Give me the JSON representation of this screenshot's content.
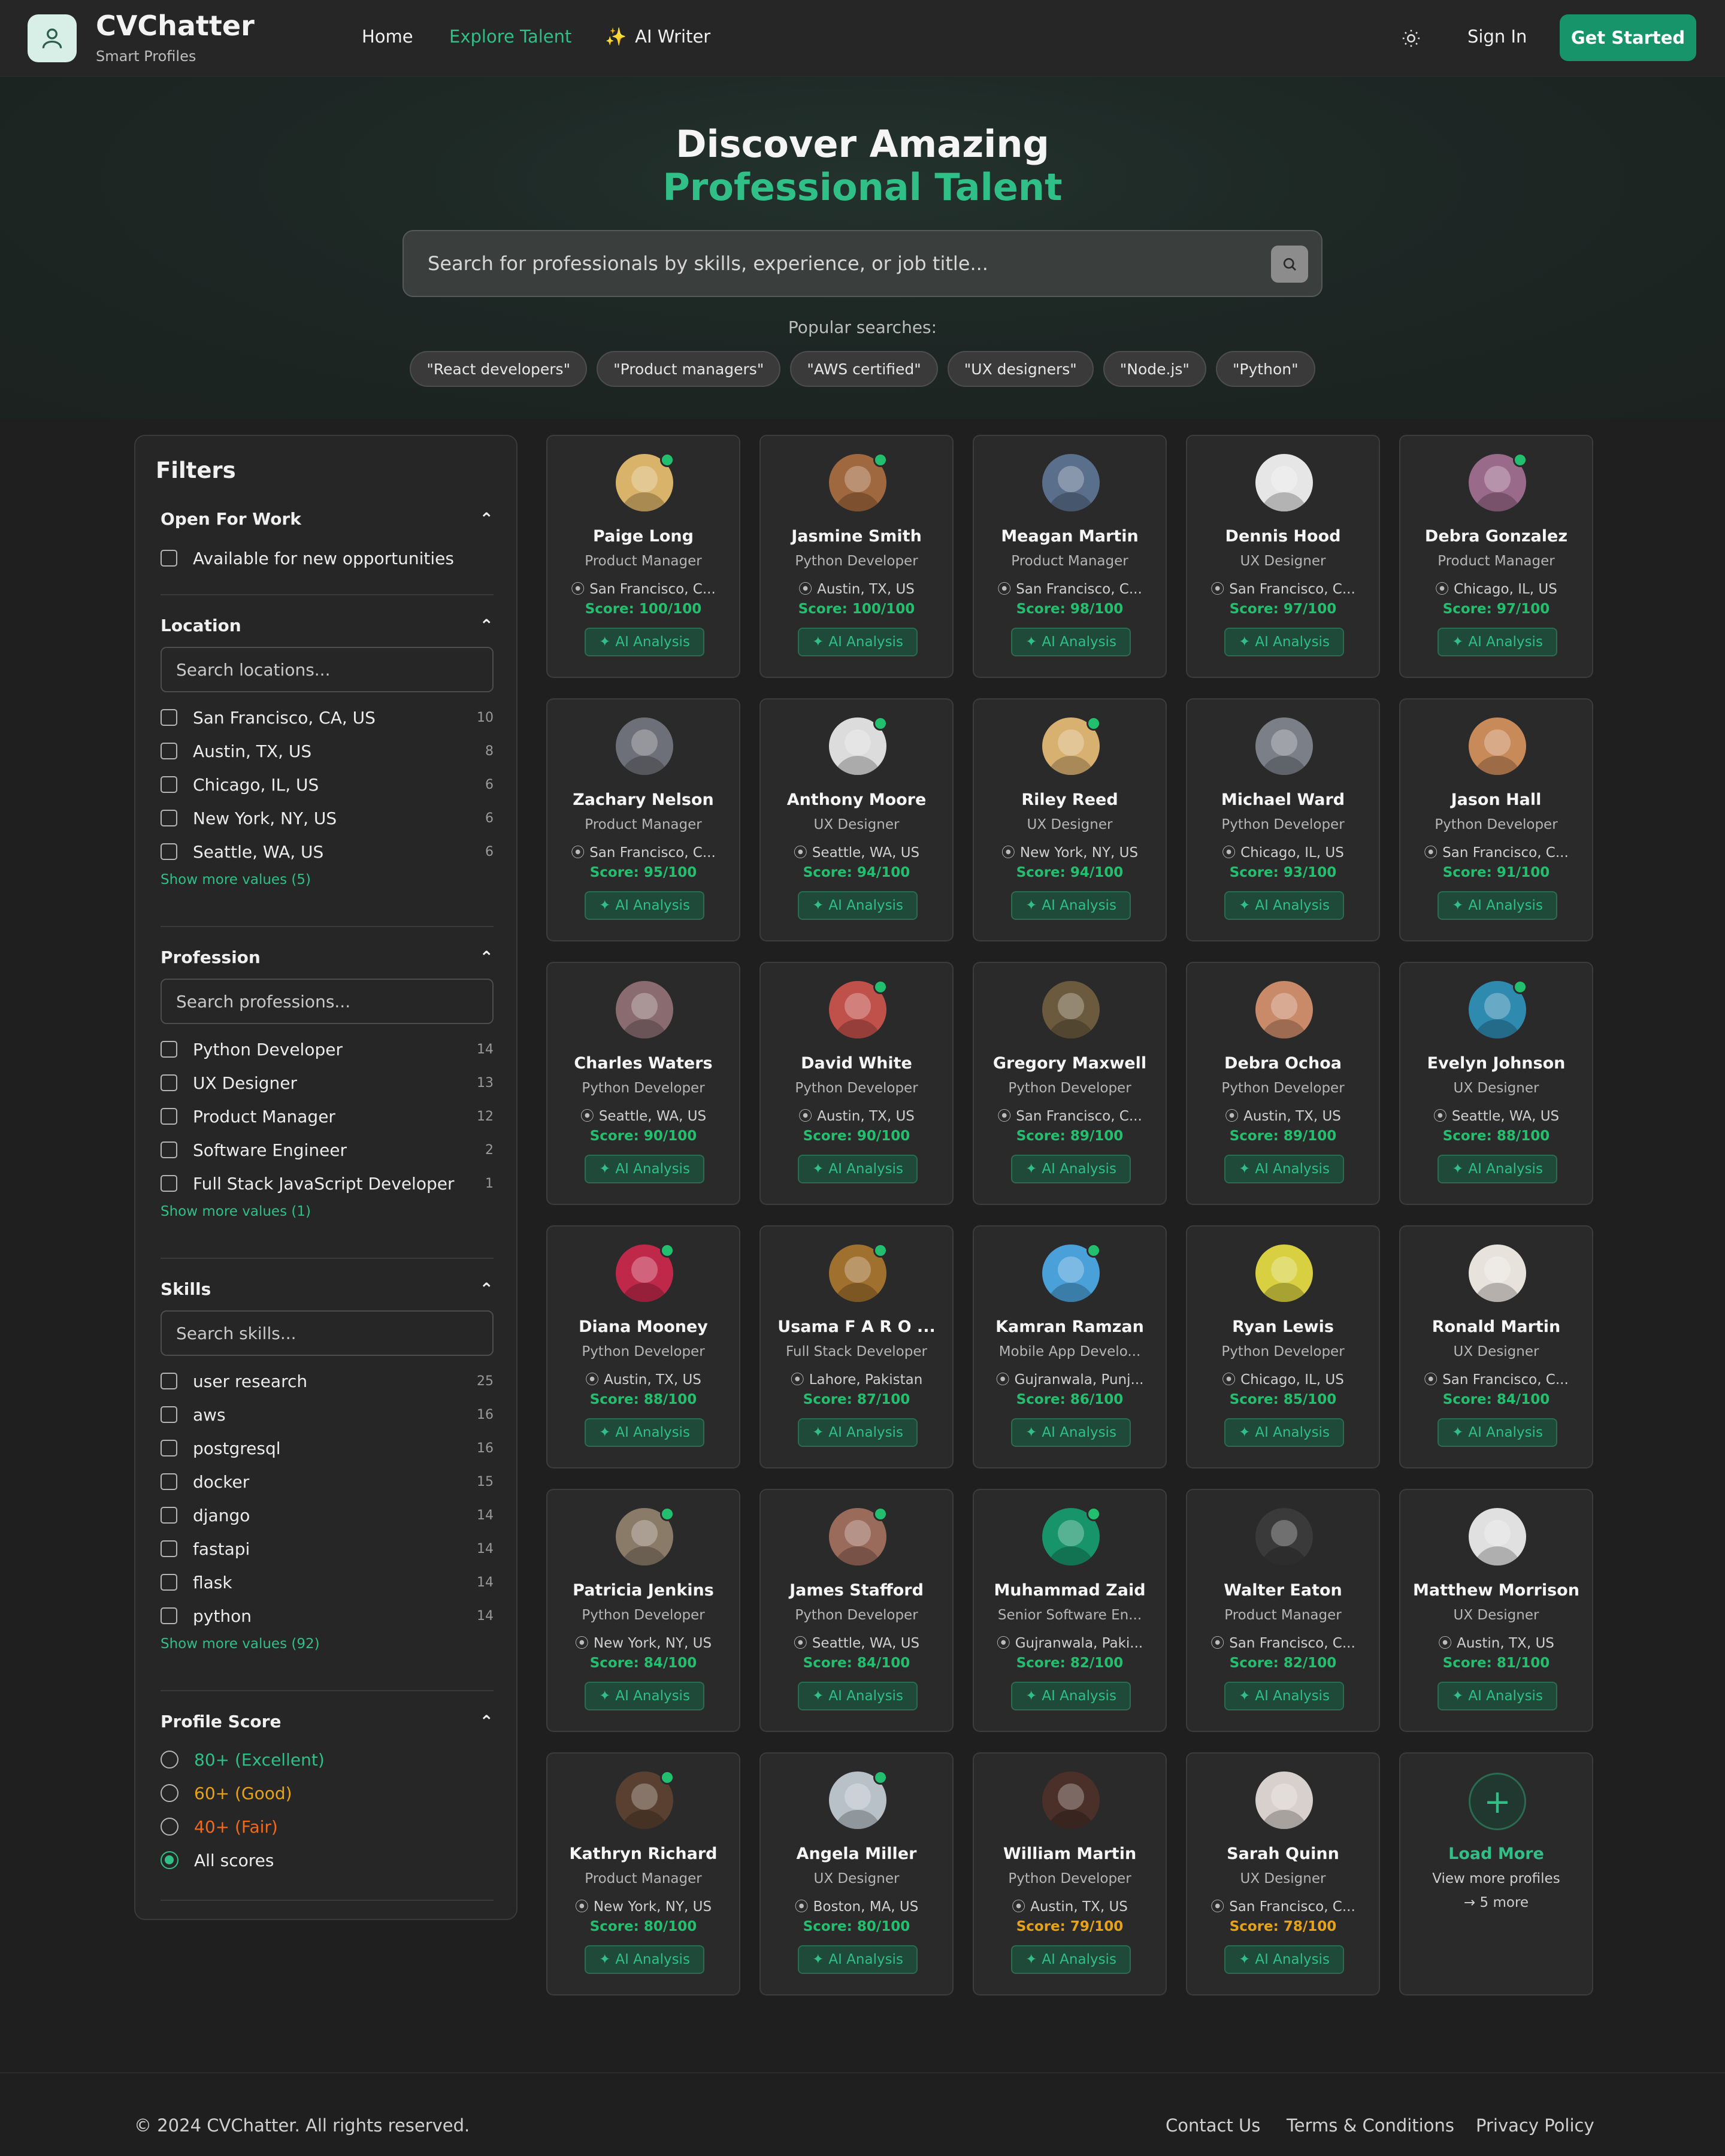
{
  "brand": {
    "name": "CVChatter",
    "tagline": "Smart Profiles"
  },
  "nav": {
    "home": "Home",
    "explore": "Explore Talent",
    "ai_writer": "AI Writer",
    "sign_in": "Sign In",
    "get_started": "Get Started"
  },
  "hero": {
    "title_line1": "Discover Amazing",
    "title_line2": "Professional Talent",
    "search_placeholder": "Search for professionals by skills, experience, or job title...",
    "popular_label": "Popular searches:",
    "popular": [
      "\"React developers\"",
      "\"Product managers\"",
      "\"AWS certified\"",
      "\"UX designers\"",
      "\"Node.js\"",
      "\"Python\""
    ]
  },
  "filters": {
    "title": "Filters",
    "open_for_work": {
      "title": "Open For Work",
      "option": "Available for new opportunities"
    },
    "location": {
      "title": "Location",
      "placeholder": "Search locations...",
      "items": [
        {
          "label": "San Francisco, CA, US",
          "count": "10"
        },
        {
          "label": "Austin, TX, US",
          "count": "8"
        },
        {
          "label": "Chicago, IL, US",
          "count": "6"
        },
        {
          "label": "New York, NY, US",
          "count": "6"
        },
        {
          "label": "Seattle, WA, US",
          "count": "6"
        }
      ],
      "show_more": "Show more values (5)"
    },
    "profession": {
      "title": "Profession",
      "placeholder": "Search professions...",
      "items": [
        {
          "label": "Python Developer",
          "count": "14"
        },
        {
          "label": "UX Designer",
          "count": "13"
        },
        {
          "label": "Product Manager",
          "count": "12"
        },
        {
          "label": "Software Engineer",
          "count": "2"
        },
        {
          "label": "Full Stack JavaScript Developer",
          "count": "1"
        }
      ],
      "show_more": "Show more values (1)"
    },
    "skills": {
      "title": "Skills",
      "placeholder": "Search skills...",
      "items": [
        {
          "label": "user research",
          "count": "25"
        },
        {
          "label": "aws",
          "count": "16"
        },
        {
          "label": "postgresql",
          "count": "16"
        },
        {
          "label": "docker",
          "count": "15"
        },
        {
          "label": "django",
          "count": "14"
        },
        {
          "label": "fastapi",
          "count": "14"
        },
        {
          "label": "flask",
          "count": "14"
        },
        {
          "label": "python",
          "count": "14"
        }
      ],
      "show_more": "Show more values (92)"
    },
    "profile_score": {
      "title": "Profile Score",
      "options": [
        {
          "label": "80+ (Excellent)",
          "color": "#2fbf87"
        },
        {
          "label": "60+ (Good)",
          "color": "#e6a317"
        },
        {
          "label": "40+ (Fair)",
          "color": "#f06a1e"
        },
        {
          "label": "All scores",
          "color": "#ececec"
        }
      ],
      "selected": "All scores"
    }
  },
  "ai_label": "AI Analysis",
  "profiles": [
    {
      "name": "Paige Long",
      "title": "Product Manager",
      "location": "San Francisco, C...",
      "score": "Score: 100/100",
      "online": true,
      "avatar_color": "#d9b36a"
    },
    {
      "name": "Jasmine Smith",
      "title": "Python Developer",
      "location": "Austin, TX, US",
      "score": "Score: 100/100",
      "online": true,
      "avatar_color": "#a0683e"
    },
    {
      "name": "Meagan Martin",
      "title": "Product Manager",
      "location": "San Francisco, C...",
      "score": "Score: 98/100",
      "online": false,
      "avatar_color": "#5a6f8c"
    },
    {
      "name": "Dennis Hood",
      "title": "UX Designer",
      "location": "San Francisco, C...",
      "score": "Score: 97/100",
      "online": false,
      "avatar_color": "#e6e6e6"
    },
    {
      "name": "Debra Gonzalez",
      "title": "Product Manager",
      "location": "Chicago, IL, US",
      "score": "Score: 97/100",
      "online": true,
      "avatar_color": "#9a6a8a"
    },
    {
      "name": "Zachary Nelson",
      "title": "Product Manager",
      "location": "San Francisco, C...",
      "score": "Score: 95/100",
      "online": false,
      "avatar_color": "#6d7078"
    },
    {
      "name": "Anthony Moore",
      "title": "UX Designer",
      "location": "Seattle, WA, US",
      "score": "Score: 94/100",
      "online": true,
      "avatar_color": "#dcdcdc"
    },
    {
      "name": "Riley Reed",
      "title": "UX Designer",
      "location": "New York, NY, US",
      "score": "Score: 94/100",
      "online": true,
      "avatar_color": "#d8b070"
    },
    {
      "name": "Michael Ward",
      "title": "Python Developer",
      "location": "Chicago, IL, US",
      "score": "Score: 93/100",
      "online": false,
      "avatar_color": "#7a7f88"
    },
    {
      "name": "Jason Hall",
      "title": "Python Developer",
      "location": "San Francisco, C...",
      "score": "Score: 91/100",
      "online": false,
      "avatar_color": "#c98a5a"
    },
    {
      "name": "Charles Waters",
      "title": "Python Developer",
      "location": "Seattle, WA, US",
      "score": "Score: 90/100",
      "online": false,
      "avatar_color": "#8a6c70"
    },
    {
      "name": "David White",
      "title": "Python Developer",
      "location": "Austin, TX, US",
      "score": "Score: 90/100",
      "online": true,
      "avatar_color": "#c0504a"
    },
    {
      "name": "Gregory Maxwell",
      "title": "Python Developer",
      "location": "San Francisco, C...",
      "score": "Score: 89/100",
      "online": false,
      "avatar_color": "#6b5a3e"
    },
    {
      "name": "Debra Ochoa",
      "title": "Python Developer",
      "location": "Austin, TX, US",
      "score": "Score: 89/100",
      "online": false,
      "avatar_color": "#c98a6a"
    },
    {
      "name": "Evelyn Johnson",
      "title": "UX Designer",
      "location": "Seattle, WA, US",
      "score": "Score: 88/100",
      "online": true,
      "avatar_color": "#2f8ab0"
    },
    {
      "name": "Diana Mooney",
      "title": "Python Developer",
      "location": "Austin, TX, US",
      "score": "Score: 88/100",
      "online": true,
      "avatar_color": "#c0284a"
    },
    {
      "name": "Usama F A R O ...",
      "title": "Full Stack Developer",
      "location": "Lahore, Pakistan",
      "score": "Score: 87/100",
      "online": true,
      "avatar_color": "#a0702e"
    },
    {
      "name": "Kamran Ramzan",
      "title": "Mobile App Develo...",
      "location": "Gujranwala, Punj...",
      "score": "Score: 86/100",
      "online": true,
      "avatar_color": "#4aa0d8"
    },
    {
      "name": "Ryan Lewis",
      "title": "Python Developer",
      "location": "Chicago, IL, US",
      "score": "Score: 85/100",
      "online": false,
      "avatar_color": "#d8d040"
    },
    {
      "name": "Ronald Martin",
      "title": "UX Designer",
      "location": "San Francisco, C...",
      "score": "Score: 84/100",
      "online": false,
      "avatar_color": "#e8e2dc"
    },
    {
      "name": "Patricia Jenkins",
      "title": "Python Developer",
      "location": "New York, NY, US",
      "score": "Score: 84/100",
      "online": true,
      "avatar_color": "#8a7a68"
    },
    {
      "name": "James Stafford",
      "title": "Python Developer",
      "location": "Seattle, WA, US",
      "score": "Score: 84/100",
      "online": true,
      "avatar_color": "#9a6a5a"
    },
    {
      "name": "Muhammad Zaid",
      "title": "Senior Software En...",
      "location": "Gujranwala, Paki...",
      "score": "Score: 82/100",
      "online": true,
      "avatar_color": "#17946a"
    },
    {
      "name": "Walter Eaton",
      "title": "Product Manager",
      "location": "San Francisco, C...",
      "score": "Score: 82/100",
      "online": false,
      "avatar_color": "#3a3a3a"
    },
    {
      "name": "Matthew Morrison",
      "title": "UX Designer",
      "location": "Austin, TX, US",
      "score": "Score: 81/100",
      "online": false,
      "avatar_color": "#e0e0e0"
    },
    {
      "name": "Kathryn Richard",
      "title": "Product Manager",
      "location": "New York, NY, US",
      "score": "Score: 80/100",
      "online": true,
      "avatar_color": "#5a4030"
    },
    {
      "name": "Angela Miller",
      "title": "UX Designer",
      "location": "Boston, MA, US",
      "score": "Score: 80/100",
      "online": true,
      "avatar_color": "#b8c0c8"
    },
    {
      "name": "William Martin",
      "title": "Python Developer",
      "location": "Austin, TX, US",
      "score": "Score: 79/100",
      "online": false,
      "avatar_color": "#4a3028"
    },
    {
      "name": "Sarah Quinn",
      "title": "UX Designer",
      "location": "San Francisco, C...",
      "score": "Score: 78/100",
      "online": false,
      "avatar_color": "#d8d0cc"
    }
  ],
  "load_more": {
    "title": "Load More",
    "subtitle": "View more profiles",
    "more": "→ 5 more"
  },
  "footer": {
    "copyright": "© 2024 CVChatter. All rights reserved.",
    "contact": "Contact Us",
    "terms": "Terms & Conditions",
    "privacy": "Privacy Policy"
  }
}
